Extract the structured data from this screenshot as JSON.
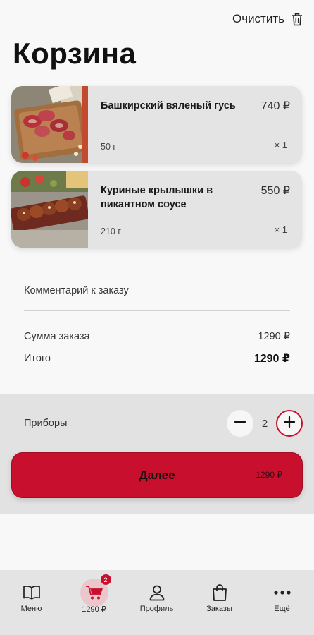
{
  "header": {
    "clear_label": "Очистить",
    "title": "Корзина"
  },
  "cart": {
    "items": [
      {
        "name": "Башкирский вяленый гусь",
        "price": "740 ₽",
        "weight": "50 г",
        "qty": "× 1",
        "image": "dried-goose-photo"
      },
      {
        "name": "Куриные крылышки в пикантном соусе",
        "price": "550 ₽",
        "weight": "210 г",
        "qty": "× 1",
        "image": "chicken-wings-photo"
      }
    ]
  },
  "comment": {
    "label": "Комментарий к заказу"
  },
  "summary": {
    "subtotal_label": "Сумма заказа",
    "subtotal_value": "1290 ₽",
    "total_label": "Итого",
    "total_value": "1290 ₽"
  },
  "cutlery": {
    "label": "Приборы",
    "count": "2"
  },
  "next_button": {
    "label": "Далее",
    "amount": "1290 ₽"
  },
  "tabbar": {
    "items": [
      {
        "label": "Меню",
        "icon": "book-icon"
      },
      {
        "label": "1290 ₽",
        "icon": "cart-icon",
        "badge": "2"
      },
      {
        "label": "Профиль",
        "icon": "profile-icon"
      },
      {
        "label": "Заказы",
        "icon": "bag-icon"
      },
      {
        "label": "Ещё",
        "icon": "more-icon"
      }
    ]
  },
  "colors": {
    "accent": "#c8102e",
    "background": "#f8f8f8",
    "card": "#e4e4e4"
  }
}
